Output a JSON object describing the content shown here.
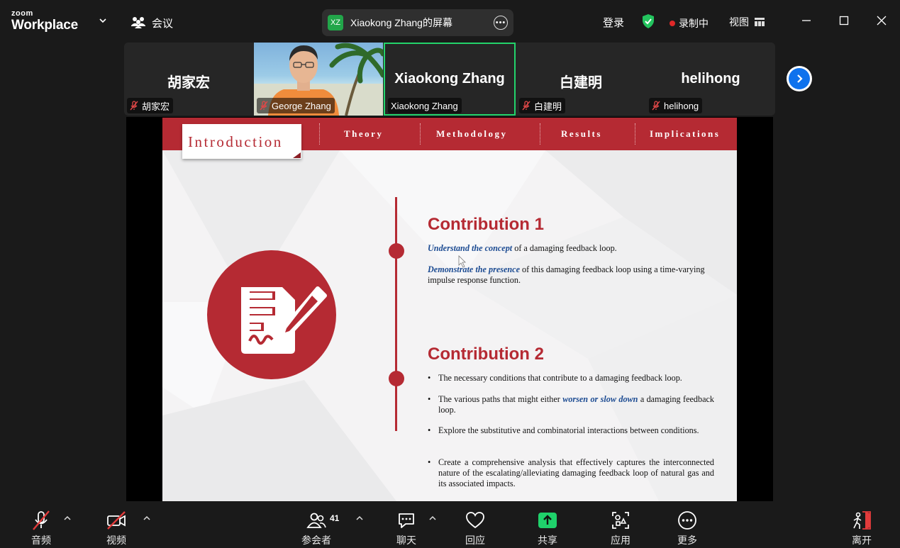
{
  "app": {
    "logo_line1": "zoom",
    "logo_line2": "Workplace",
    "meeting_label": "会议"
  },
  "share": {
    "badge": "XZ",
    "title": "Xiaokong Zhang的屏幕"
  },
  "topbar": {
    "login": "登录",
    "recording": "录制中",
    "view": "视图"
  },
  "participants": [
    {
      "display": "胡家宏",
      "tag": "胡家宏",
      "video": false,
      "active": false
    },
    {
      "display": "",
      "tag": "George Zhang",
      "video": true,
      "active": false
    },
    {
      "display": "Xiaokong Zhang",
      "tag": "Xiaokong Zhang",
      "video": false,
      "active": true
    },
    {
      "display": "白建明",
      "tag": "白建明",
      "video": false,
      "active": false
    },
    {
      "display": "helihong",
      "tag": "helihong",
      "video": false,
      "active": false
    }
  ],
  "slide": {
    "nav": {
      "active": "Introduction",
      "tabs": [
        "Theory",
        "Methodology",
        "Results",
        "Implications"
      ]
    },
    "contribution1": {
      "title": "Contribution 1",
      "p1_em": "Understand the concept",
      "p1_rest": " of a damaging feedback loop.",
      "p2_em": "Demonstrate the presence",
      "p2_rest": " of this damaging feedback loop using a time-varying impulse response function."
    },
    "contribution2": {
      "title": "Contribution 2",
      "b1": "The necessary conditions that contribute to a damaging feedback loop.",
      "b2_pre": "The various paths that might either ",
      "b2_em": "worsen or slow down",
      "b2_post": " a damaging feedback loop.",
      "b3": "Explore the substitutive and combinatorial interactions between conditions.",
      "b4": "Create a comprehensive analysis that effectively captures the interconnected nature of the escalating/alleviating damaging feedback loop of natural gas and its associated impacts."
    }
  },
  "toolbar": {
    "audio": "音频",
    "video": "视频",
    "participants": "参会者",
    "participants_count": "41",
    "chat": "聊天",
    "react": "回应",
    "share": "共享",
    "apps": "应用",
    "more": "更多",
    "leave": "离开"
  },
  "colors": {
    "accent_red": "#b52a33",
    "active_green": "#23d36b",
    "share_green": "#1fd16b",
    "brand_blue": "#0e72ed",
    "emphasis_blue": "#1c4b92"
  }
}
